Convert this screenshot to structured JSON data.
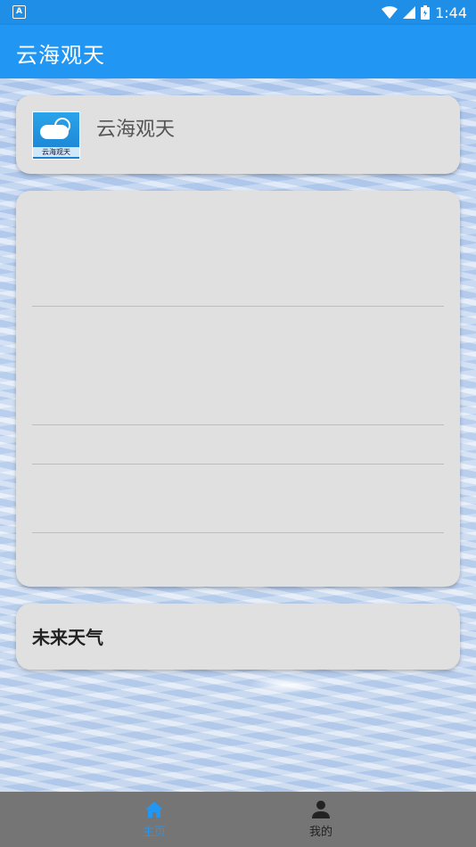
{
  "status": {
    "left_icon": "A",
    "time": "1:44",
    "icons": [
      "wifi-icon",
      "signal-icon",
      "battery-icon"
    ]
  },
  "appbar": {
    "title": "云海观天"
  },
  "header_card": {
    "logo_text": "云海观天",
    "title": "云海观天"
  },
  "forecast_card": {
    "title": "未来天气"
  },
  "bottom_nav": {
    "items": [
      {
        "label": "主页",
        "icon": "home-icon",
        "active": true
      },
      {
        "label": "我的",
        "icon": "person-icon",
        "active": false
      }
    ]
  },
  "colors": {
    "appbar": "#2196f3",
    "statusbar": "#1f8ee6",
    "card": "#e0e0e0",
    "nav_bg": "#757575",
    "active": "#2196f3"
  }
}
